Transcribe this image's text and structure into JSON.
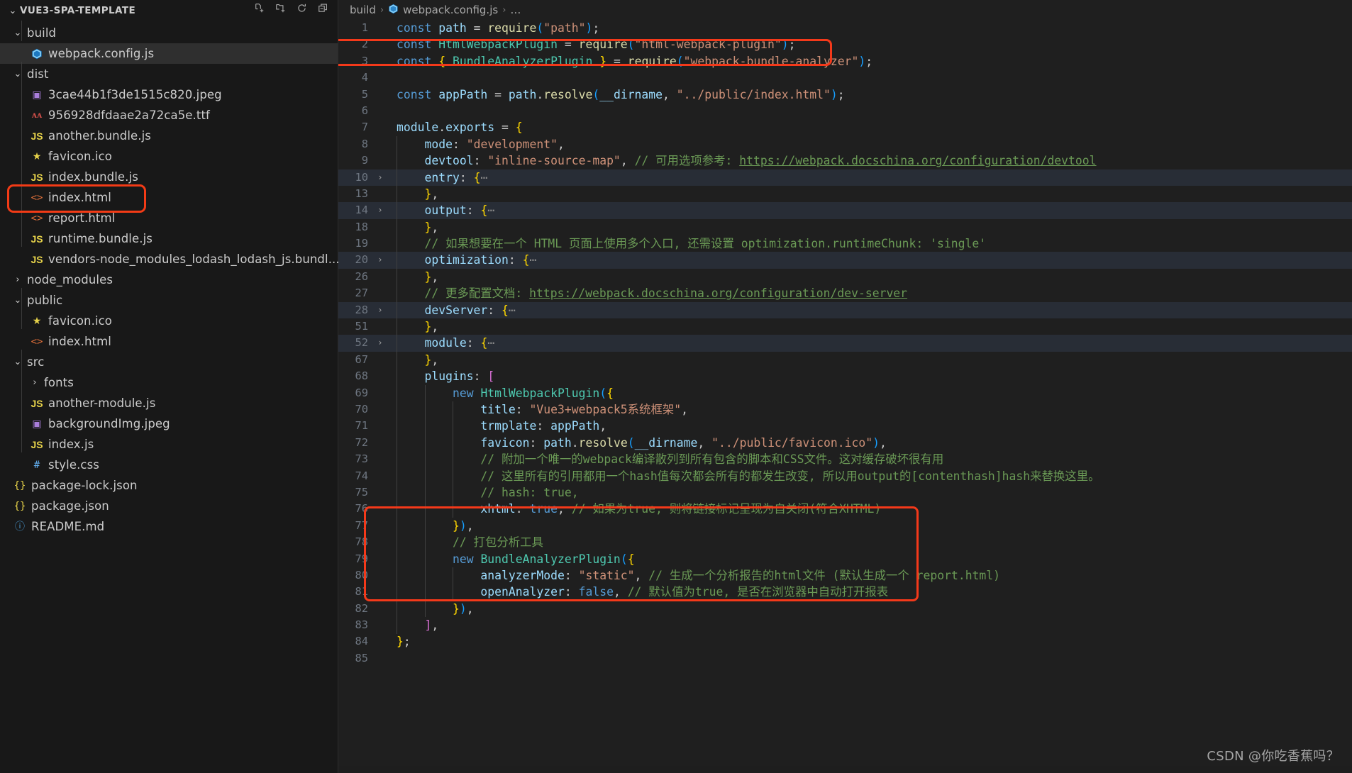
{
  "sidebar": {
    "title": "VUE3-SPA-TEMPLATE",
    "actions": [
      {
        "name": "new-file-icon",
        "label": "New File"
      },
      {
        "name": "new-folder-icon",
        "label": "New Folder"
      },
      {
        "name": "refresh-icon",
        "label": "Refresh Explorer"
      },
      {
        "name": "collapse-all-icon",
        "label": "Collapse Folders in Explorer"
      }
    ],
    "items": [
      {
        "label": "build",
        "type": "folder",
        "state": "expanded",
        "indent": 1,
        "icon": "chevron-down-icon"
      },
      {
        "label": "webpack.config.js",
        "type": "file",
        "indent": 2,
        "icon": "webpack-icon",
        "selected": true
      },
      {
        "label": "dist",
        "type": "folder",
        "state": "expanded",
        "indent": 1,
        "icon": "chevron-down-icon"
      },
      {
        "label": "3cae44b1f3de1515c820.jpeg",
        "type": "file",
        "indent": 2,
        "icon": "image-icon"
      },
      {
        "label": "956928dfdaae2a72ca5e.ttf",
        "type": "file",
        "indent": 2,
        "icon": "font-icon"
      },
      {
        "label": "another.bundle.js",
        "type": "file",
        "indent": 2,
        "icon": "js-icon"
      },
      {
        "label": "favicon.ico",
        "type": "file",
        "indent": 2,
        "icon": "star-icon"
      },
      {
        "label": "index.bundle.js",
        "type": "file",
        "indent": 2,
        "icon": "js-icon"
      },
      {
        "label": "index.html",
        "type": "file",
        "indent": 2,
        "icon": "html-icon"
      },
      {
        "label": "report.html",
        "type": "file",
        "indent": 2,
        "icon": "html-icon",
        "highlighted": true
      },
      {
        "label": "runtime.bundle.js",
        "type": "file",
        "indent": 2,
        "icon": "js-icon"
      },
      {
        "label": "vendors-node_modules_lodash_lodash_js.bundl...",
        "type": "file",
        "indent": 2,
        "icon": "js-icon"
      },
      {
        "label": "node_modules",
        "type": "folder",
        "state": "collapsed",
        "indent": 1,
        "icon": "chevron-right-icon"
      },
      {
        "label": "public",
        "type": "folder",
        "state": "expanded",
        "indent": 1,
        "icon": "chevron-down-icon"
      },
      {
        "label": "favicon.ico",
        "type": "file",
        "indent": 2,
        "icon": "star-icon"
      },
      {
        "label": "index.html",
        "type": "file",
        "indent": 2,
        "icon": "html-icon"
      },
      {
        "label": "src",
        "type": "folder",
        "state": "expanded",
        "indent": 1,
        "icon": "chevron-down-icon"
      },
      {
        "label": "fonts",
        "type": "folder",
        "state": "collapsed",
        "indent": 2,
        "icon": "chevron-right-icon"
      },
      {
        "label": "another-module.js",
        "type": "file",
        "indent": 2,
        "icon": "js-icon"
      },
      {
        "label": "backgroundImg.jpeg",
        "type": "file",
        "indent": 2,
        "icon": "image-icon"
      },
      {
        "label": "index.js",
        "type": "file",
        "indent": 2,
        "icon": "js-icon"
      },
      {
        "label": "style.css",
        "type": "file",
        "indent": 2,
        "icon": "css-icon"
      },
      {
        "label": "package-lock.json",
        "type": "file",
        "indent": 1,
        "icon": "json-icon"
      },
      {
        "label": "package.json",
        "type": "file",
        "indent": 1,
        "icon": "json-icon"
      },
      {
        "label": "README.md",
        "type": "file",
        "indent": 1,
        "icon": "markdown-icon"
      }
    ]
  },
  "breadcrumb": {
    "folder": "build",
    "file": "webpack.config.js",
    "more": "…",
    "separator": "›"
  },
  "editor": {
    "language": "javascript",
    "file": "webpack.config.js",
    "lines": [
      {
        "no": "1",
        "text": "const path = require(\"path\");"
      },
      {
        "no": "2",
        "text": "const HtmlWebpackPlugin = require(\"html-webpack-plugin\");"
      },
      {
        "no": "3",
        "text": "const { BundleAnalyzerPlugin } = require(\"webpack-bundle-analyzer\");"
      },
      {
        "no": "4",
        "text": ""
      },
      {
        "no": "5",
        "text": "const appPath = path.resolve(__dirname, \"../public/index.html\");"
      },
      {
        "no": "6",
        "text": ""
      },
      {
        "no": "7",
        "text": "module.exports = {"
      },
      {
        "no": "8",
        "text": "    mode: \"development\","
      },
      {
        "no": "9",
        "text": "    devtool: \"inline-source-map\", // 可用选项参考: https://webpack.docschina.org/configuration/devtool"
      },
      {
        "no": "10",
        "text": "    entry: {⋯",
        "folded": true
      },
      {
        "no": "13",
        "text": "    },"
      },
      {
        "no": "14",
        "text": "    output: {⋯",
        "folded": true
      },
      {
        "no": "18",
        "text": "    },"
      },
      {
        "no": "19",
        "text": "    // 如果想要在一个 HTML 页面上使用多个入口, 还需设置 optimization.runtimeChunk: 'single'"
      },
      {
        "no": "20",
        "text": "    optimization: {⋯",
        "folded": true
      },
      {
        "no": "26",
        "text": "    },"
      },
      {
        "no": "27",
        "text": "    // 更多配置文档: https://webpack.docschina.org/configuration/dev-server"
      },
      {
        "no": "28",
        "text": "    devServer: {⋯",
        "folded": true
      },
      {
        "no": "51",
        "text": "    },"
      },
      {
        "no": "52",
        "text": "    module: {⋯",
        "folded": true
      },
      {
        "no": "67",
        "text": "    },"
      },
      {
        "no": "68",
        "text": "    plugins: ["
      },
      {
        "no": "69",
        "text": "        new HtmlWebpackPlugin({"
      },
      {
        "no": "70",
        "text": "            title: \"Vue3+webpack5系统框架\","
      },
      {
        "no": "71",
        "text": "            trmplate: appPath,"
      },
      {
        "no": "72",
        "text": "            favicon: path.resolve(__dirname, \"../public/favicon.ico\"),"
      },
      {
        "no": "73",
        "text": "            // 附加一个唯一的webpack编译散列到所有包含的脚本和CSS文件。这对缓存破坏很有用"
      },
      {
        "no": "74",
        "text": "            // 这里所有的引用都用一个hash值每次都会所有的都发生改变, 所以用output的[contenthash]hash来替换这里。"
      },
      {
        "no": "75",
        "text": "            // hash: true,"
      },
      {
        "no": "76",
        "text": "            xhtml: true, // 如果为true, 则将链接标记呈现为自关闭(符合XHTML)"
      },
      {
        "no": "77",
        "text": "        }),"
      },
      {
        "no": "78",
        "text": "        // 打包分析工具"
      },
      {
        "no": "79",
        "text": "        new BundleAnalyzerPlugin({"
      },
      {
        "no": "80",
        "text": "            analyzerMode: \"static\", // 生成一个分析报告的html文件 (默认生成一个 report.html)"
      },
      {
        "no": "81",
        "text": "            openAnalyzer: false, // 默认值为true, 是否在浏览器中自动打开报表"
      },
      {
        "no": "82",
        "text": "        }),"
      },
      {
        "no": "83",
        "text": "    ],"
      },
      {
        "no": "84",
        "text": "};"
      },
      {
        "no": "85",
        "text": ""
      }
    ]
  },
  "annotations": [
    {
      "name": "highlight-report-html",
      "target": "report.html"
    },
    {
      "name": "highlight-bundle-analyzer-require",
      "target": "line 3"
    },
    {
      "name": "highlight-bundle-analyzer-plugin-block",
      "target": "lines 78-82"
    }
  ],
  "watermark": {
    "text": "CSDN @你吃香蕉吗？"
  },
  "colors": {
    "accent_highlight": "#f4391a",
    "editor_background": "#1f1f1f",
    "sidebar_background": "#181818",
    "selection_background": "#2f2f2f",
    "fold_background": "#282d36",
    "comment": "#6a9955",
    "string": "#ce9178",
    "keyword": "#569cd6",
    "class_name": "#4ec9b0",
    "function": "#dcdcaa"
  }
}
